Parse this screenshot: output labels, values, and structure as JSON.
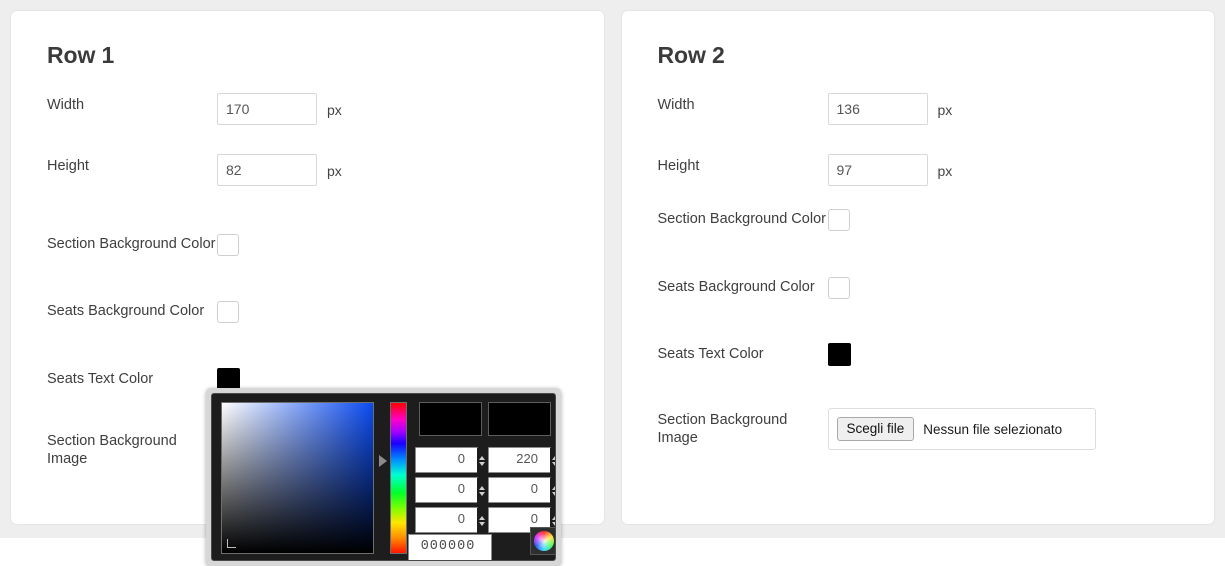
{
  "page": {
    "background_color": "#eeeeee",
    "card_background": "#ffffff"
  },
  "cards": [
    {
      "title": "Row 1",
      "fields": {
        "width_label": "Width",
        "width_value": "170",
        "width_unit": "px",
        "height_label": "Height",
        "height_value": "82",
        "height_unit": "px",
        "section_bg_color_label": "Section Background Color",
        "section_bg_color_value": "#ffffff",
        "seats_bg_color_label": "Seats Background Color",
        "seats_bg_color_value": "#ffffff",
        "seats_text_color_label": "Seats Text Color",
        "seats_text_color_value": "#000000",
        "section_bg_image_label": "Section Background Image"
      }
    },
    {
      "title": "Row 2",
      "fields": {
        "width_label": "Width",
        "width_value": "136",
        "width_unit": "px",
        "height_label": "Height",
        "height_value": "97",
        "height_unit": "px",
        "section_bg_color_label": "Section Background Color",
        "section_bg_color_value": "#ffffff",
        "seats_bg_color_label": "Seats Background Color",
        "seats_bg_color_value": "#ffffff",
        "seats_text_color_label": "Seats Text Color",
        "seats_text_color_value": "#000000",
        "section_bg_image_label": "Section Background Image",
        "file_button_label": "Scegli file",
        "file_status_text": "Nessun file selezionato"
      }
    }
  ],
  "color_dialog": {
    "name": "native-color-picker",
    "preview_new_color": "#000000",
    "preview_old_color": "#000000",
    "hue_selected": "#0b4bf0",
    "spin_fields": [
      {
        "name": "hue",
        "value": "0"
      },
      {
        "name": "red",
        "value": "0"
      },
      {
        "name": "saturation",
        "value": "0"
      },
      {
        "name": "green",
        "value": "0"
      },
      {
        "name": "value",
        "value": "0"
      },
      {
        "name": "blue",
        "value": "0"
      }
    ],
    "spin_top_right_value": "220",
    "hex_value": "000000",
    "wheel_button_label": "color-wheel"
  }
}
